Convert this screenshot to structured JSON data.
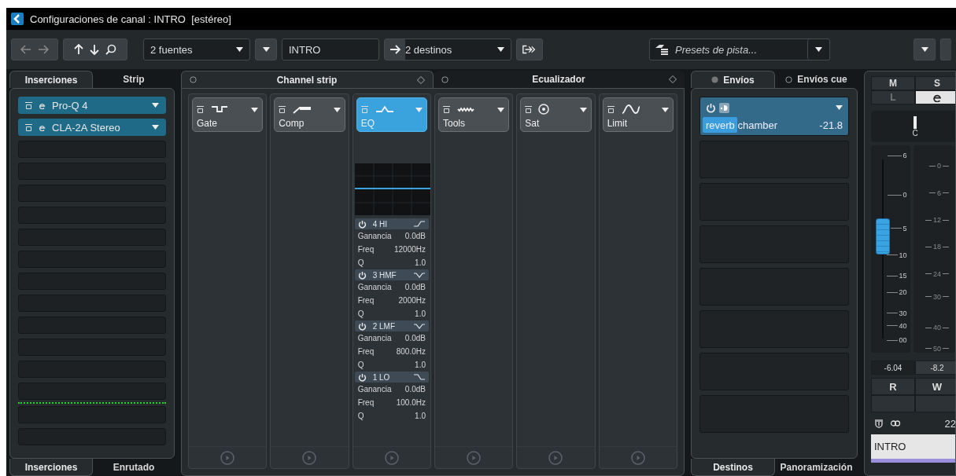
{
  "window": {
    "title": "Configuraciones de canal : INTRO  [estéreo]"
  },
  "toolbar": {
    "sources": "2 fuentes",
    "channel_name": "INTRO",
    "destinations": "2 destinos",
    "presets": {
      "placeholder": "Presets de pista..."
    }
  },
  "inserts_panel": {
    "tabs": [
      {
        "label": "Inserciones",
        "selected": true
      },
      {
        "label": "Strip",
        "selected": false
      }
    ],
    "slots": [
      {
        "kind": "slot",
        "name": "Pro-Q 4",
        "active": true
      },
      {
        "kind": "slot",
        "name": "CLA-2A Stereo",
        "active": true
      },
      {
        "kind": "slot",
        "active": false
      },
      {
        "kind": "slot",
        "active": false
      },
      {
        "kind": "slot",
        "active": false
      },
      {
        "kind": "slot",
        "active": false
      },
      {
        "kind": "slot",
        "active": false
      },
      {
        "kind": "slot",
        "active": false
      },
      {
        "kind": "slot",
        "active": false
      },
      {
        "kind": "slot",
        "active": false
      },
      {
        "kind": "slot",
        "active": false
      },
      {
        "kind": "slot",
        "active": false
      },
      {
        "kind": "slot",
        "active": false
      },
      {
        "kind": "slot",
        "active": false
      },
      {
        "kind": "post-fader-line"
      },
      {
        "kind": "slot",
        "active": false
      },
      {
        "kind": "slot",
        "active": false
      }
    ],
    "bottom_tabs": [
      {
        "label": "Inserciones",
        "selected": true
      },
      {
        "label": "Enrutado",
        "selected": false
      }
    ]
  },
  "strip_panel": {
    "sections": [
      "Channel strip",
      "Ecualizador"
    ],
    "modules": [
      {
        "kind": "gate",
        "label": "Gate",
        "selected": false
      },
      {
        "kind": "comp",
        "label": "Comp",
        "selected": false
      },
      {
        "kind": "eq",
        "label": "EQ",
        "selected": true
      },
      {
        "kind": "tools",
        "label": "Tools",
        "selected": false
      },
      {
        "kind": "sat",
        "label": "Sat",
        "selected": false
      },
      {
        "kind": "limit",
        "label": "Limit",
        "selected": false
      }
    ],
    "eq_bands": [
      {
        "name": "4 HI",
        "kind": "high-shelf",
        "params": [
          {
            "label": "Ganancia",
            "value": "0.0dB"
          },
          {
            "label": "Freq",
            "value": "12000Hz"
          },
          {
            "label": "Q",
            "value": "1.0"
          }
        ]
      },
      {
        "name": "3 HMF",
        "kind": "bell",
        "params": [
          {
            "label": "Ganancia",
            "value": "0.0dB"
          },
          {
            "label": "Freq",
            "value": "2000Hz"
          },
          {
            "label": "Q",
            "value": "1.0"
          }
        ]
      },
      {
        "name": "2 LMF",
        "kind": "bell",
        "params": [
          {
            "label": "Ganancia",
            "value": "0.0dB"
          },
          {
            "label": "Freq",
            "value": "800.0Hz"
          },
          {
            "label": "Q",
            "value": "1.0"
          }
        ]
      },
      {
        "name": "1 LO",
        "kind": "low-shelf",
        "params": [
          {
            "label": "Ganancia",
            "value": "0.0dB"
          },
          {
            "label": "Freq",
            "value": "100.0Hz"
          },
          {
            "label": "Q",
            "value": "1.0"
          }
        ]
      }
    ]
  },
  "sends_panel": {
    "tabs": [
      {
        "label": "Envíos",
        "selected": true
      },
      {
        "label": "Envíos cue",
        "selected": false
      }
    ],
    "sends": [
      {
        "name": "reverb chamber",
        "value": "-21.8",
        "level": 0.24,
        "active": true
      },
      {
        "active": false
      },
      {
        "active": false
      },
      {
        "active": false
      },
      {
        "active": false
      },
      {
        "active": false
      },
      {
        "active": false
      },
      {
        "active": false
      }
    ],
    "bottom_tabs": [
      {
        "label": "Destinos",
        "selected": true
      },
      {
        "label": "Panoramización",
        "selected": false
      }
    ]
  },
  "fader_panel": {
    "mute": "M",
    "solo": "S",
    "listen": "L",
    "pan": "C",
    "fader_scale": [
      "6",
      "0",
      "5",
      "10",
      "15",
      "20",
      "30",
      "40",
      "00"
    ],
    "meter_scale": [
      "0",
      "6",
      "12",
      "18",
      "24",
      "30",
      "40",
      "50"
    ],
    "level": 0.57,
    "volume": "-6.04",
    "peak": "-8.2",
    "read": "R",
    "write": "W",
    "number": "22",
    "name": "INTRO"
  }
}
